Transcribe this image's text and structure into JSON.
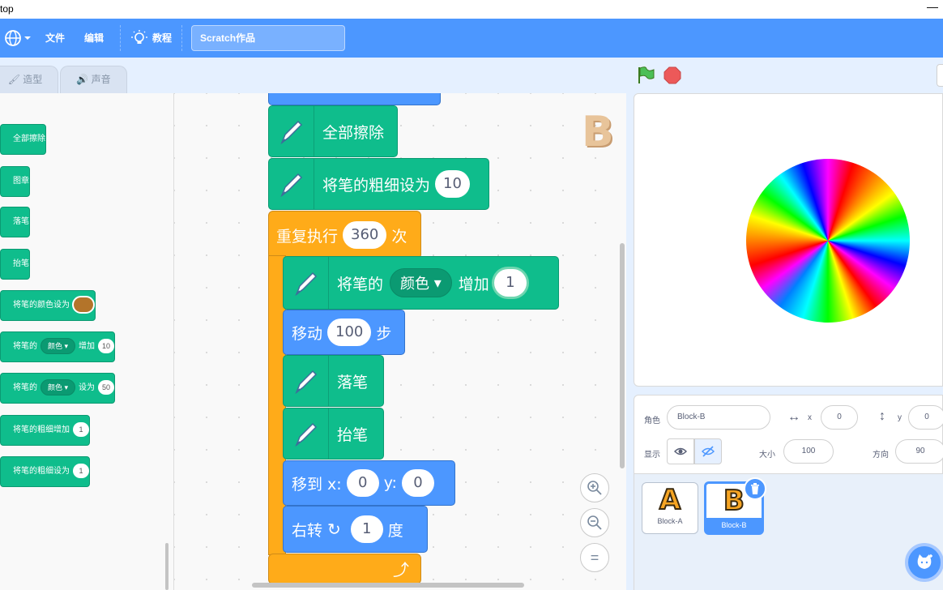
{
  "window": {
    "title": "top",
    "minimize_label": "—"
  },
  "menubar": {
    "file_label": "文件",
    "edit_label": "编辑",
    "tutorial_label": "教程",
    "project_title": "Scratch作品"
  },
  "tabs": {
    "costumes": "造型",
    "sounds": "声音"
  },
  "palette": {
    "blocks": [
      {
        "label": "全部擦除"
      },
      {
        "label": "图章"
      },
      {
        "label": "落笔"
      },
      {
        "label": "抬笔"
      },
      {
        "label": "将笔的颜色设为"
      },
      {
        "pre": "将笔的",
        "dropdown": "颜色",
        "mid": "增加",
        "value": "10"
      },
      {
        "pre": "将笔的",
        "dropdown": "颜色",
        "mid": "设为",
        "value": "50"
      },
      {
        "label": "将笔的粗细增加",
        "value": "1"
      },
      {
        "label": "将笔的粗细设为",
        "value": "1"
      }
    ]
  },
  "script": {
    "clear": "全部擦除",
    "set_size_label": "将笔的粗细设为",
    "set_size_value": "10",
    "repeat_label": "重复执行",
    "repeat_value": "360",
    "repeat_unit": "次",
    "change_pre": "将笔的",
    "change_dropdown": "颜色",
    "change_mid": "增加",
    "change_value": "1",
    "move_label": "移动",
    "move_value": "100",
    "move_unit": "步",
    "pen_down": "落笔",
    "pen_up": "抬笔",
    "goto_label": "移到 x:",
    "goto_x": "0",
    "goto_y_label": "y:",
    "goto_y": "0",
    "turn_label": "右转",
    "turn_value": "1",
    "turn_unit": "度"
  },
  "sprite_info": {
    "sprite_label": "角色",
    "sprite_name": "Block-B",
    "x_label": "x",
    "x_value": "0",
    "y_label": "y",
    "y_value": "0",
    "show_label": "显示",
    "size_label": "大小",
    "size_value": "100",
    "direction_label": "方向",
    "direction_value": "90"
  },
  "sprites": [
    {
      "name": "Block-A",
      "glyph": "A"
    },
    {
      "name": "Block-B",
      "glyph": "B"
    }
  ],
  "zoom_reset_label": "=",
  "ghost_sprite_glyph": "B",
  "colors": {
    "menu_blue": "#4c97ff",
    "pen_green": "#0fbd8c",
    "control_orange": "#ffab19",
    "motion_blue": "#4c97ff",
    "pen_color_swatch": "#b3742a"
  }
}
